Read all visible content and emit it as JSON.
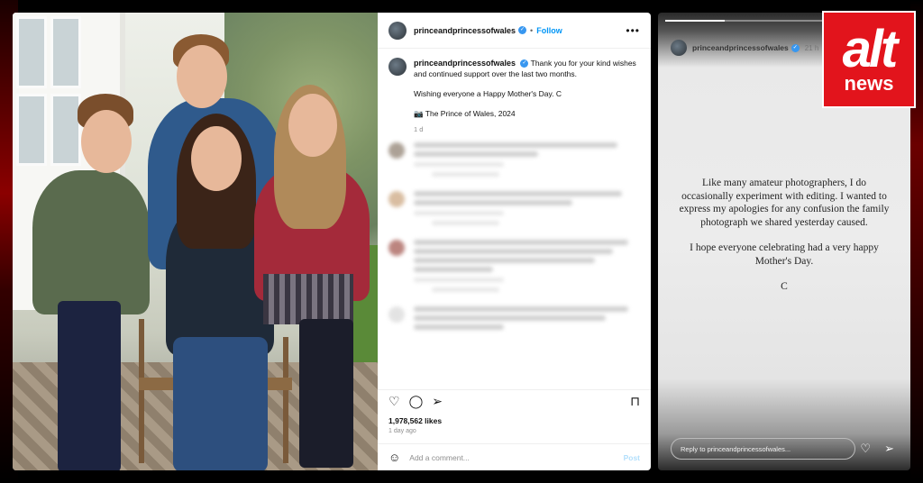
{
  "post": {
    "username": "princeandprincessofwales",
    "follow_label": "Follow",
    "more_label": "•••",
    "caption_line1": "Thank you for your kind wishes and continued support over the last two months.",
    "caption_line2": "Wishing everyone a Happy Mother's Day. C",
    "caption_line3": "📷 The Prince of Wales, 2024",
    "caption_time": "1 d",
    "likes": "1,978,562 likes",
    "posted_ago": "1 day ago",
    "add_comment_placeholder": "Add a comment...",
    "post_button": "Post"
  },
  "story": {
    "username": "princeandprincessofwales",
    "time": "21 h",
    "message_paragraph1": "Like many amateur photographers, I do occasionally experiment with editing. I wanted to express my apologies for any confusion the family photograph we shared yesterday caused.",
    "message_paragraph2": "I hope everyone celebrating had a very happy Mother's Day.",
    "message_signature": "C",
    "reply_placeholder": "Reply to princeandprincessofwales...",
    "progress": 0.25
  },
  "logo": {
    "line1": "alt",
    "line2": "news"
  },
  "colors": {
    "accent_blue": "#0095f6",
    "verified_blue": "#3897f0",
    "brand_red": "#e2141c"
  },
  "icons": [
    "verified-icon",
    "more-icon",
    "heart-icon",
    "comment-icon",
    "share-icon",
    "bookmark-icon",
    "emoji-icon",
    "send-icon"
  ]
}
